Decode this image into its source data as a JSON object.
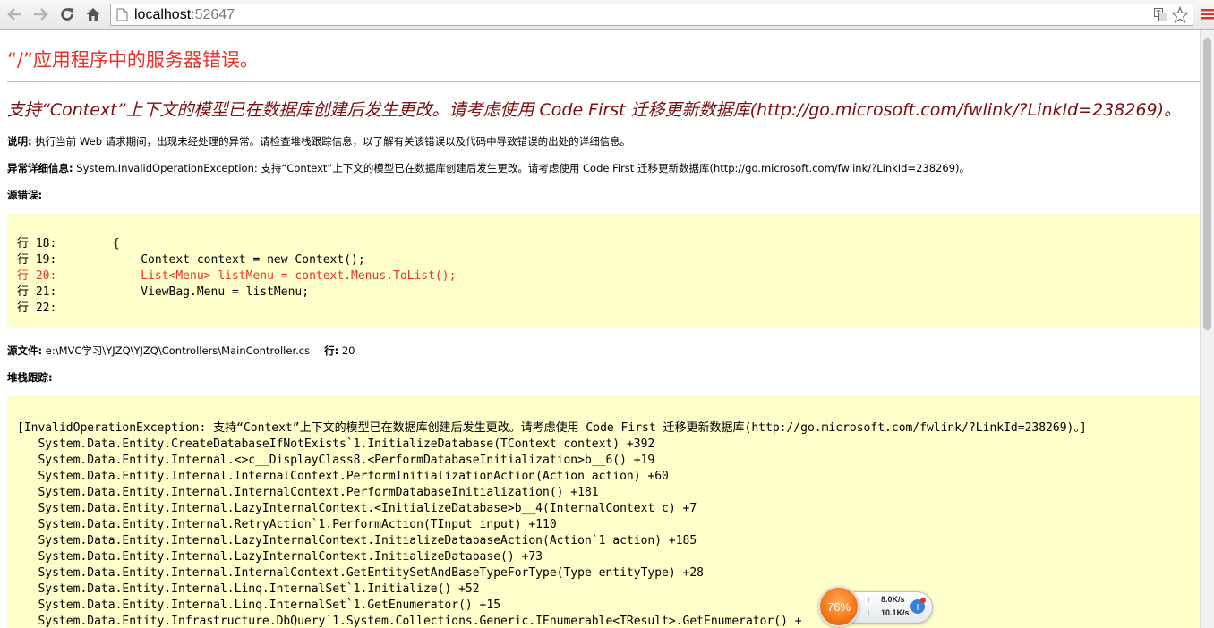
{
  "browser": {
    "url_host": "localhost",
    "url_port": ":52647"
  },
  "page": {
    "title": "“/”应用程序中的服务器错误。",
    "message": "支持“Context”上下文的模型已在数据库创建后发生更改。请考虑使用 Code First 迁移更新数据库(http://go.microsoft.com/fwlink/?LinkId=238269)。",
    "description_label": "说明:",
    "description_text": " 执行当前 Web 请求期间，出现未经处理的异常。请检查堆栈跟踪信息，以了解有关该错误以及代码中导致错误的出处的详细信息。",
    "exception_label": "异常详细信息:",
    "exception_text": " System.InvalidOperationException: 支持“Context”上下文的模型已在数据库创建后发生更改。请考虑使用 Code First 迁移更新数据库(http://go.microsoft.com/fwlink/?LinkId=238269)。",
    "source_error_label": "源错误:",
    "source_lines": [
      "行 18:        {",
      "行 19:            Context context = new Context();",
      "行 20:            List<Menu> listMenu = context.Menus.ToList();",
      "行 21:            ViewBag.Menu = listMenu;",
      "行 22:"
    ],
    "source_file_label": "源文件:",
    "source_file_value": " e:\\MVC学习\\YJZQ\\YJZQ\\Controllers\\MainController.cs",
    "line_label": "行:",
    "line_value": " 20",
    "stack_label": "堆栈跟踪:",
    "stack_lines": [
      "[InvalidOperationException: 支持“Context”上下文的模型已在数据库创建后发生更改。请考虑使用 Code First 迁移更新数据库(http://go.microsoft.com/fwlink/?LinkId=238269)。]",
      "   System.Data.Entity.CreateDatabaseIfNotExists`1.InitializeDatabase(TContext context) +392",
      "   System.Data.Entity.Internal.<>c__DisplayClass8.<PerformDatabaseInitialization>b__6() +19",
      "   System.Data.Entity.Internal.InternalContext.PerformInitializationAction(Action action) +60",
      "   System.Data.Entity.Internal.InternalContext.PerformDatabaseInitialization() +181",
      "   System.Data.Entity.Internal.LazyInternalContext.<InitializeDatabase>b__4(InternalContext c) +7",
      "   System.Data.Entity.Internal.RetryAction`1.PerformAction(TInput input) +110",
      "   System.Data.Entity.Internal.LazyInternalContext.InitializeDatabaseAction(Action`1 action) +185",
      "   System.Data.Entity.Internal.LazyInternalContext.InitializeDatabase() +73",
      "   System.Data.Entity.Internal.InternalContext.GetEntitySetAndBaseTypeForType(Type entityType) +28",
      "   System.Data.Entity.Internal.Linq.InternalSet`1.Initialize() +52",
      "   System.Data.Entity.Internal.Linq.InternalSet`1.GetEnumerator() +15",
      "   System.Data.Entity.Infrastructure.DbQuery`1.System.Collections.Generic.IEnumerable<TResult>.GetEnumerator() +"
    ]
  },
  "net_widget": {
    "percent": "76%",
    "upload": "8.0K/s",
    "download": "10.1K/s"
  },
  "colors": {
    "title_red": "#e8332b",
    "message_maroon": "#7d0e0e",
    "code_bg": "#ffffcc",
    "highlight_red": "#e8332b"
  }
}
